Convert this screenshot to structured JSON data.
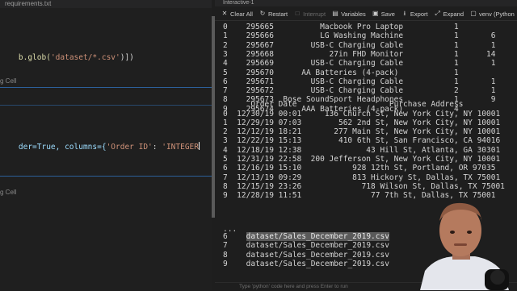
{
  "editor": {
    "tab_label": "requirements.txt",
    "code_line_1": {
      "a": "b.glob(",
      "b": "'dataset/*.csv'",
      "c": ")])"
    },
    "cell_label_1": "g Cell",
    "cell_label_2": "g Cell",
    "code_line_2": {
      "a": "der=True, columns={",
      "b": "'Order ID'",
      "c": ": ",
      "d": "'INTEGER"
    },
    "cell_label_3": "g Cell"
  },
  "interactive": {
    "tab_label": "Interactive-1",
    "toolbar": {
      "clear_all": "Clear All",
      "restart": "Restart",
      "interrupt": "Interrupt",
      "variables": "Variables",
      "save": "Save",
      "export": "Export",
      "expand": "Expand",
      "kernel": "venv (Python"
    },
    "table1_rows": [
      "0    295665          Macbook Pro Laptop           1        ",
      "1    295666          LG Washing Machine           1       6",
      "2    295667        USB-C Charging Cable           1       1",
      "3    295668            27in FHD Monitor           1      14",
      "4    295669        USB-C Charging Cable           1       1",
      "5    295670      AA Batteries (4-pack)            1        ",
      "6    295671        USB-C Charging Cable           1       1",
      "7    295672        USB-C Charging Cable           2       1",
      "8    295673  Bose SoundSport Headphones           1       9",
      "9    295674      AAA Batteries (4-pack)           4        "
    ],
    "table2_header": "      Order Date                    Purchase Address",
    "table2_rows": [
      "0  12/30/19 00:01     136 Church St, New York City, NY 10001",
      "1  12/29/19 07:03        562 2nd St, New York City, NY 10001",
      "2  12/12/19 18:21       277 Main St, New York City, NY 10001",
      "3  12/22/19 15:13        410 6th St, San Francisco, CA 94016",
      "4  12/18/19 12:38              43 Hill St, Atlanta, GA 30301",
      "5  12/31/19 22:58  200 Jefferson St, New York City, NY 10001",
      "6  12/16/19 15:10           928 12th St, Portland, OR 97035",
      "7  12/13/19 09:29           813 Hickory St, Dallas, TX 75001",
      "8  12/15/19 23:26             718 Wilson St, Dallas, TX 75001",
      "9  12/28/19 11:51               77 7th St, Dallas, TX 75001"
    ],
    "ellipsis": "...",
    "file_rows": [
      {
        "idx": "6",
        "path": "dataset/Sales_December_2019.csv"
      },
      {
        "idx": "7",
        "path": "dataset/Sales_December_2019.csv"
      },
      {
        "idx": "8",
        "path": "dataset/Sales_December_2019.csv"
      },
      {
        "idx": "9",
        "path": "dataset/Sales_December_2019.csv"
      }
    ],
    "input_placeholder": "Type 'python' code here and press Enter to run"
  },
  "colors": {
    "accent": "#3794ff",
    "highlight": "#5a5a5a"
  }
}
